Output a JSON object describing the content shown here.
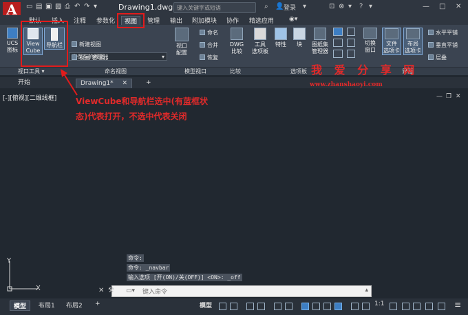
{
  "app": {
    "title": "Drawing1.dwg",
    "search_placeholder": "键入关键字或短语",
    "login": "登录"
  },
  "ribbon_tabs": [
    "默认",
    "插入",
    "注释",
    "参数化",
    "视图",
    "管理",
    "输出",
    "附加模块",
    "协作",
    "精选应用"
  ],
  "active_tab": "视图",
  "ribbon": {
    "ucs_icon": "UCS\n图标",
    "view_cube": "View\nCube",
    "navbar": "导航栏",
    "unsaved_view": "未保存的视图",
    "new_view": "新建视图",
    "view_manager": "视图 管理器",
    "viewport_config": "视口\n配置",
    "named": "命名",
    "join": "合并",
    "restore": "恢复",
    "dwg_compare": "DWG\n比较",
    "tool_palettes": "工具\n选项板",
    "properties": "特性",
    "block": "块",
    "sheetset": "图纸集\n管理器",
    "switch_window": "切换\n窗口",
    "file_tabs": "文件\n选项卡",
    "layout_tabs": "布局\n选项卡",
    "tile_horizontal": "水平平铺",
    "tile_vertical": "垂直平铺",
    "cascade": "层叠"
  },
  "panels": {
    "viewport_tools": "视口工具",
    "named_views": "命名视图",
    "model_viewports": "模型视口",
    "compare": "比较",
    "palettes": "选项板",
    "interface": "界面"
  },
  "file_tabs": {
    "start": "开始",
    "drawing": "Drawing1*",
    "add": "+"
  },
  "viewport_label": "[-][俯视][二维线框]",
  "annotation": {
    "line1": "ViewCube和导航栏选中(有蓝框状",
    "line2": "态)代表打开，不选中代表关闭"
  },
  "watermark": {
    "text": "我 爱 分 享 网",
    "url": "www.zhanshaoyi.com"
  },
  "command_history": [
    "命令:",
    "命令: _navbar",
    "输入选项 [开(ON)/关(OFF)] <ON>: _off"
  ],
  "command_placeholder": "键入命令",
  "axis": {
    "y": "Y",
    "x": "X"
  },
  "status_tabs": [
    "模型",
    "布局1",
    "布局2"
  ],
  "status": {
    "model_button": "模型",
    "scale": "1:1"
  },
  "colors": {
    "accent_blue": "#3d7ec3",
    "annotation_red": "#e02a2a",
    "logo_red": "#b81e1e"
  }
}
